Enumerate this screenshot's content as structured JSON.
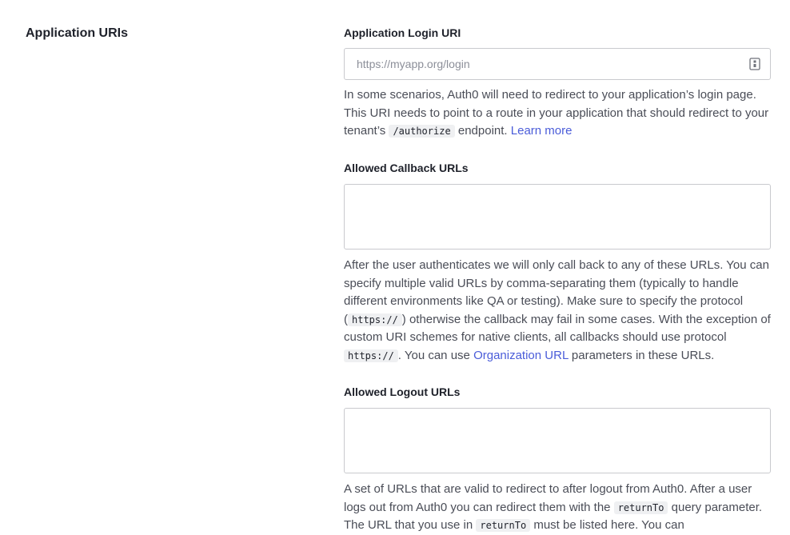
{
  "section": {
    "title": "Application URIs"
  },
  "login_uri": {
    "label": "Application Login URI",
    "placeholder": "https://myapp.org/login",
    "help_1": "In some scenarios, Auth0 will need to redirect to your application’s login page. This URI needs to point to a route in your application that should redirect to your tenant’s",
    "help_code": "/authorize",
    "help_2": "endpoint.",
    "learn_more": "Learn more"
  },
  "callback_urls": {
    "label": "Allowed Callback URLs",
    "value": "",
    "help_1": "After the user authenticates we will only call back to any of these URLs. You can specify multiple valid URLs by comma-separating them (typically to handle different environments like QA or testing). Make sure to specify the protocol (",
    "help_code_1": "https://",
    "help_2": ") otherwise the callback may fail in some cases. With the exception of custom URI schemes for native clients, all callbacks should use protocol",
    "help_code_2": "https://",
    "help_3": ". You can use",
    "org_link": "Organization URL",
    "help_4": "parameters in these URLs."
  },
  "logout_urls": {
    "label": "Allowed Logout URLs",
    "value": "",
    "help_1": "A set of URLs that are valid to redirect to after logout from Auth0. After a user logs out from Auth0 you can redirect them with the",
    "help_code_1": "returnTo",
    "help_2": "query parameter. The URL that you use in",
    "help_code_2": "returnTo",
    "help_3": "must be listed here. You can"
  }
}
